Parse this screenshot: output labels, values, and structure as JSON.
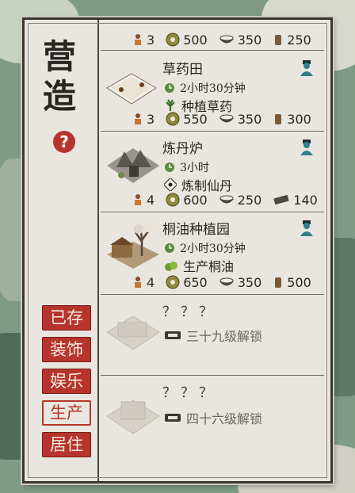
{
  "panel": {
    "title_line1": "营",
    "title_line2": "造",
    "help": "?"
  },
  "categories": [
    {
      "label": "已存",
      "active": false
    },
    {
      "label": "装饰",
      "active": false
    },
    {
      "label": "娱乐",
      "active": false
    },
    {
      "label": "生产",
      "active": true
    },
    {
      "label": "居住",
      "active": false
    }
  ],
  "top_costs": {
    "workers": "3",
    "coins": "500",
    "rice": "350",
    "wood": "250"
  },
  "buildings": [
    {
      "name": "草药田",
      "time": "2小时30分钟",
      "product": "种植草药",
      "costs": {
        "workers": "3",
        "coins": "550",
        "rice": "350",
        "material": "300"
      }
    },
    {
      "name": "炼丹炉",
      "time": "3小时",
      "product": "炼制仙丹",
      "costs": {
        "workers": "4",
        "coins": "600",
        "rice": "250",
        "material": "140"
      }
    },
    {
      "name": "桐油种植园",
      "time": "2小时30分钟",
      "product": "生产桐油",
      "costs": {
        "workers": "4",
        "coins": "650",
        "rice": "350",
        "material": "500"
      }
    }
  ],
  "locked": [
    {
      "name": "？？？",
      "unlock": "三十九级解锁"
    },
    {
      "name": "？？？",
      "unlock": "四十六级解锁"
    }
  ],
  "colors": {
    "accent": "#b7342c",
    "panel": "#e9e6df",
    "ink": "#2a2522"
  }
}
